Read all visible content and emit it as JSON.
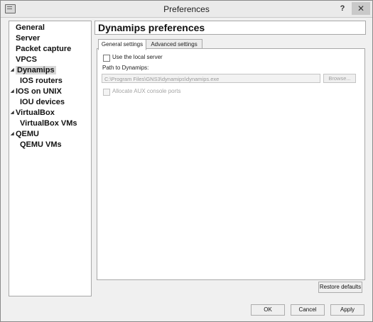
{
  "window": {
    "title": "Preferences",
    "help": "?",
    "close": "✕"
  },
  "sidebar": {
    "items": [
      {
        "label": "General"
      },
      {
        "label": "Server"
      },
      {
        "label": "Packet capture"
      },
      {
        "label": "VPCS"
      },
      {
        "label": "Dynamips",
        "selected": true,
        "expanded": true
      },
      {
        "label": "IOS routers"
      },
      {
        "label": "IOS on UNIX",
        "expanded": true
      },
      {
        "label": "IOU devices"
      },
      {
        "label": "VirtualBox",
        "expanded": true
      },
      {
        "label": "VirtualBox VMs"
      },
      {
        "label": "QEMU",
        "expanded": true
      },
      {
        "label": "QEMU VMs"
      }
    ]
  },
  "main": {
    "title": "Dynamips preferences",
    "tabs": [
      {
        "label": "General settings",
        "active": true
      },
      {
        "label": "Advanced settings",
        "active": false
      }
    ],
    "general": {
      "use_local_server_label": "Use the local server",
      "path_label": "Path to Dynamips:",
      "path_value": "C:\\Program Files\\GNS3\\dynamips\\dynamips.exe",
      "browse_label": "Browse...",
      "allocate_aux_label": "Allocate AUX console ports"
    },
    "restore_defaults_label": "Restore defaults"
  },
  "footer": {
    "ok_label": "OK",
    "cancel_label": "Cancel",
    "apply_label": "Apply"
  }
}
